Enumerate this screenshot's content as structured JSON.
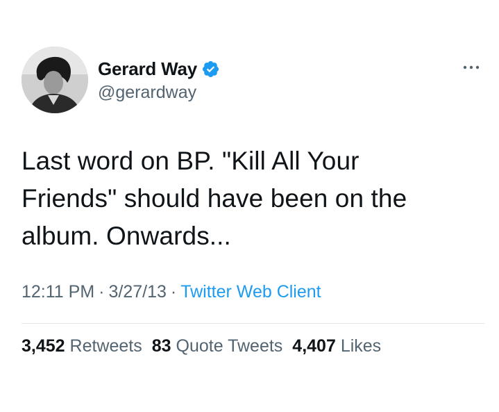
{
  "author": {
    "display_name": "Gerard Way",
    "handle": "@gerardway",
    "verified": true,
    "avatar": "avatar-photo"
  },
  "tweet": {
    "text_lines": [
      "Last word on BP. \"Kill All Your",
      "Friends\" should have been on the",
      "album. Onwards..."
    ],
    "time": "12:11 PM",
    "separator": "·",
    "date": "3/27/13",
    "client": "Twitter Web Client"
  },
  "stats": {
    "retweets_count": "3,452",
    "retweets_label": "Retweets",
    "quotes_count": "83",
    "quotes_label": "Quote Tweets",
    "likes_count": "4,407",
    "likes_label": "Likes"
  },
  "icons": {
    "verified": "verified-badge-icon",
    "more": "more-options-icon"
  },
  "colors": {
    "text": "#0f1419",
    "secondary": "#536471",
    "accent": "#1d9bf0",
    "divider": "#e3e6e8"
  }
}
